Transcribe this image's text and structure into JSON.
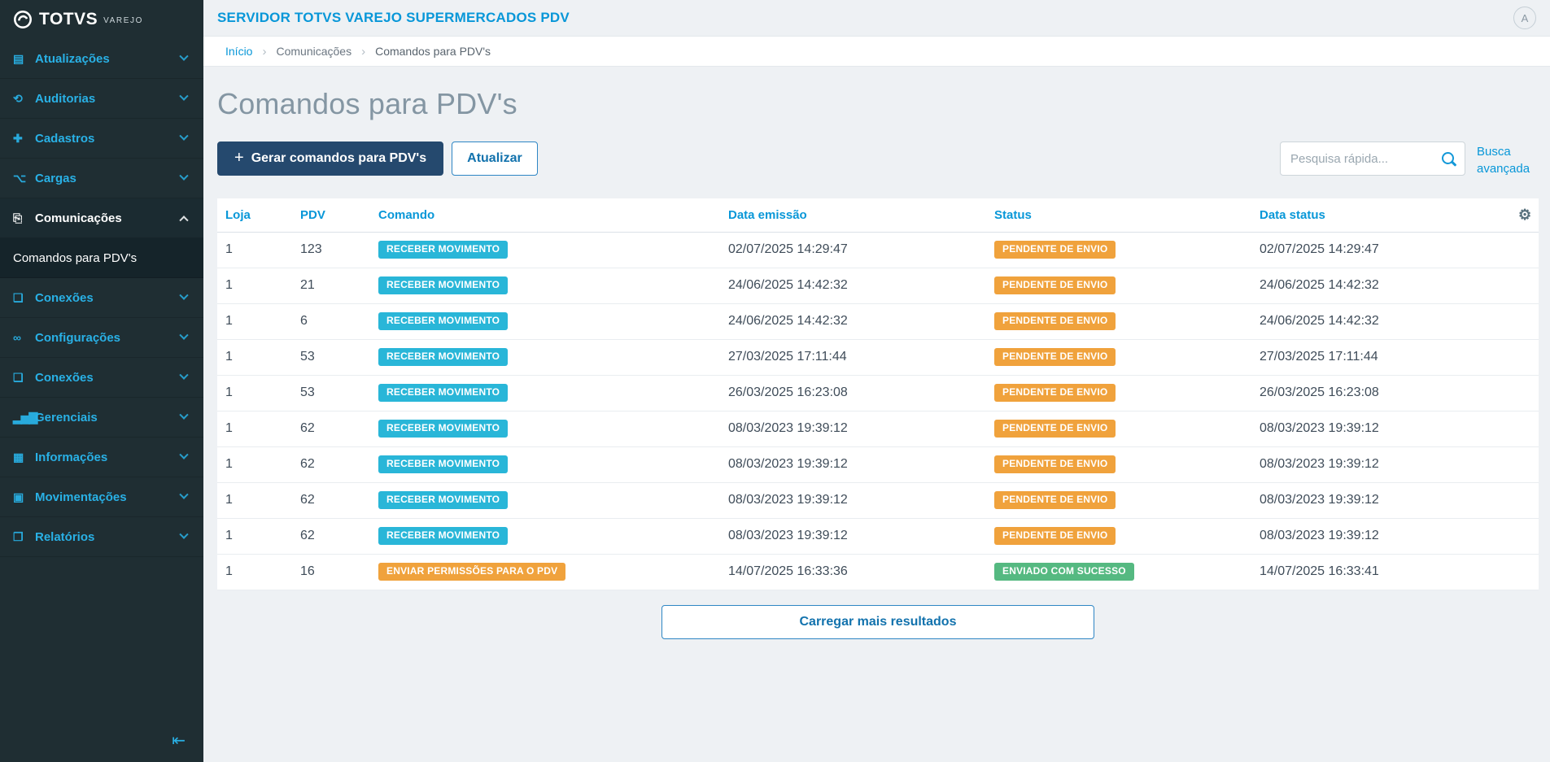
{
  "app": {
    "brand": "TOTVS",
    "brand_sub": "VAREJO"
  },
  "header": {
    "title": "SERVIDOR TOTVS VAREJO SUPERMERCADOS PDV",
    "avatar_label": "A"
  },
  "breadcrumb": {
    "items": [
      "Início",
      "Comunicações",
      "Comandos para PDV's"
    ]
  },
  "page": {
    "title": "Comandos para PDV's"
  },
  "toolbar": {
    "generate_button": "Gerar comandos para PDV's",
    "refresh_button": "Atualizar",
    "search_placeholder": "Pesquisa rápida...",
    "advanced_search": "Busca avançada"
  },
  "sidebar": {
    "items": [
      {
        "id": "atualizacoes",
        "label": "Atualizações",
        "icon": "grid"
      },
      {
        "id": "auditorias",
        "label": "Auditorias",
        "icon": "history"
      },
      {
        "id": "cadastros",
        "label": "Cadastros",
        "icon": "person-plus"
      },
      {
        "id": "cargas",
        "label": "Cargas",
        "icon": "share"
      },
      {
        "id": "comunicacoes",
        "label": "Comunicações",
        "icon": "file-export",
        "expanded": true,
        "children": [
          {
            "label": "Comandos para PDV's",
            "active": true
          }
        ]
      },
      {
        "id": "conexoes",
        "label": "Conexões",
        "icon": "file"
      },
      {
        "id": "configuracoes",
        "label": "Configurações",
        "icon": "link"
      },
      {
        "id": "conexoes-2",
        "label": "Conexões",
        "icon": "file"
      },
      {
        "id": "gerenciais",
        "label": "Gerenciais",
        "icon": "chart"
      },
      {
        "id": "informacoes",
        "label": "Informações",
        "icon": "building"
      },
      {
        "id": "movimentacoes",
        "label": "Movimentações",
        "icon": "save"
      },
      {
        "id": "relatorios",
        "label": "Relatórios",
        "icon": "document"
      }
    ]
  },
  "icons": {
    "grid": "▤",
    "history": "⟲",
    "person-plus": "✚",
    "share": "⌥",
    "file-export": "⎘",
    "file": "❏",
    "link": "∞",
    "chart": "▂▅▇",
    "building": "▦",
    "save": "▣",
    "document": "❐",
    "gear": "⚙",
    "collapse": "⇤",
    "plus": "+"
  },
  "table": {
    "columns": [
      "Loja",
      "PDV",
      "Comando",
      "Data emissão",
      "Status",
      "Data status"
    ],
    "rows": [
      {
        "loja": "1",
        "pdv": "123",
        "comando": "RECEBER MOVIMENTO",
        "comando_variant": "info",
        "data_emissao": "02/07/2025 14:29:47",
        "status": "PENDENTE DE ENVIO",
        "status_variant": "warning",
        "data_status": "02/07/2025 14:29:47"
      },
      {
        "loja": "1",
        "pdv": "21",
        "comando": "RECEBER MOVIMENTO",
        "comando_variant": "info",
        "data_emissao": "24/06/2025 14:42:32",
        "status": "PENDENTE DE ENVIO",
        "status_variant": "warning",
        "data_status": "24/06/2025 14:42:32"
      },
      {
        "loja": "1",
        "pdv": "6",
        "comando": "RECEBER MOVIMENTO",
        "comando_variant": "info",
        "data_emissao": "24/06/2025 14:42:32",
        "status": "PENDENTE DE ENVIO",
        "status_variant": "warning",
        "data_status": "24/06/2025 14:42:32"
      },
      {
        "loja": "1",
        "pdv": "53",
        "comando": "RECEBER MOVIMENTO",
        "comando_variant": "info",
        "data_emissao": "27/03/2025 17:11:44",
        "status": "PENDENTE DE ENVIO",
        "status_variant": "warning",
        "data_status": "27/03/2025 17:11:44"
      },
      {
        "loja": "1",
        "pdv": "53",
        "comando": "RECEBER MOVIMENTO",
        "comando_variant": "info",
        "data_emissao": "26/03/2025 16:23:08",
        "status": "PENDENTE DE ENVIO",
        "status_variant": "warning",
        "data_status": "26/03/2025 16:23:08"
      },
      {
        "loja": "1",
        "pdv": "62",
        "comando": "RECEBER MOVIMENTO",
        "comando_variant": "info",
        "data_emissao": "08/03/2023 19:39:12",
        "status": "PENDENTE DE ENVIO",
        "status_variant": "warning",
        "data_status": "08/03/2023 19:39:12"
      },
      {
        "loja": "1",
        "pdv": "62",
        "comando": "RECEBER MOVIMENTO",
        "comando_variant": "info",
        "data_emissao": "08/03/2023 19:39:12",
        "status": "PENDENTE DE ENVIO",
        "status_variant": "warning",
        "data_status": "08/03/2023 19:39:12"
      },
      {
        "loja": "1",
        "pdv": "62",
        "comando": "RECEBER MOVIMENTO",
        "comando_variant": "info",
        "data_emissao": "08/03/2023 19:39:12",
        "status": "PENDENTE DE ENVIO",
        "status_variant": "warning",
        "data_status": "08/03/2023 19:39:12"
      },
      {
        "loja": "1",
        "pdv": "62",
        "comando": "RECEBER MOVIMENTO",
        "comando_variant": "info",
        "data_emissao": "08/03/2023 19:39:12",
        "status": "PENDENTE DE ENVIO",
        "status_variant": "warning",
        "data_status": "08/03/2023 19:39:12"
      },
      {
        "loja": "1",
        "pdv": "16",
        "comando": "ENVIAR PERMISSÕES PARA O PDV",
        "comando_variant": "warning",
        "data_emissao": "14/07/2025 16:33:36",
        "status": "ENVIADO COM SUCESSO",
        "status_variant": "success",
        "data_status": "14/07/2025 16:33:41"
      }
    ]
  },
  "footer": {
    "load_more": "Carregar mais resultados"
  },
  "colors": {
    "accent": "#0897d8",
    "sidebar_link": "#29b1e6",
    "badge_info": "#29b6d8",
    "badge_warning": "#f0a23c",
    "badge_success": "#55b981",
    "primary_button_bg": "#25496e"
  }
}
